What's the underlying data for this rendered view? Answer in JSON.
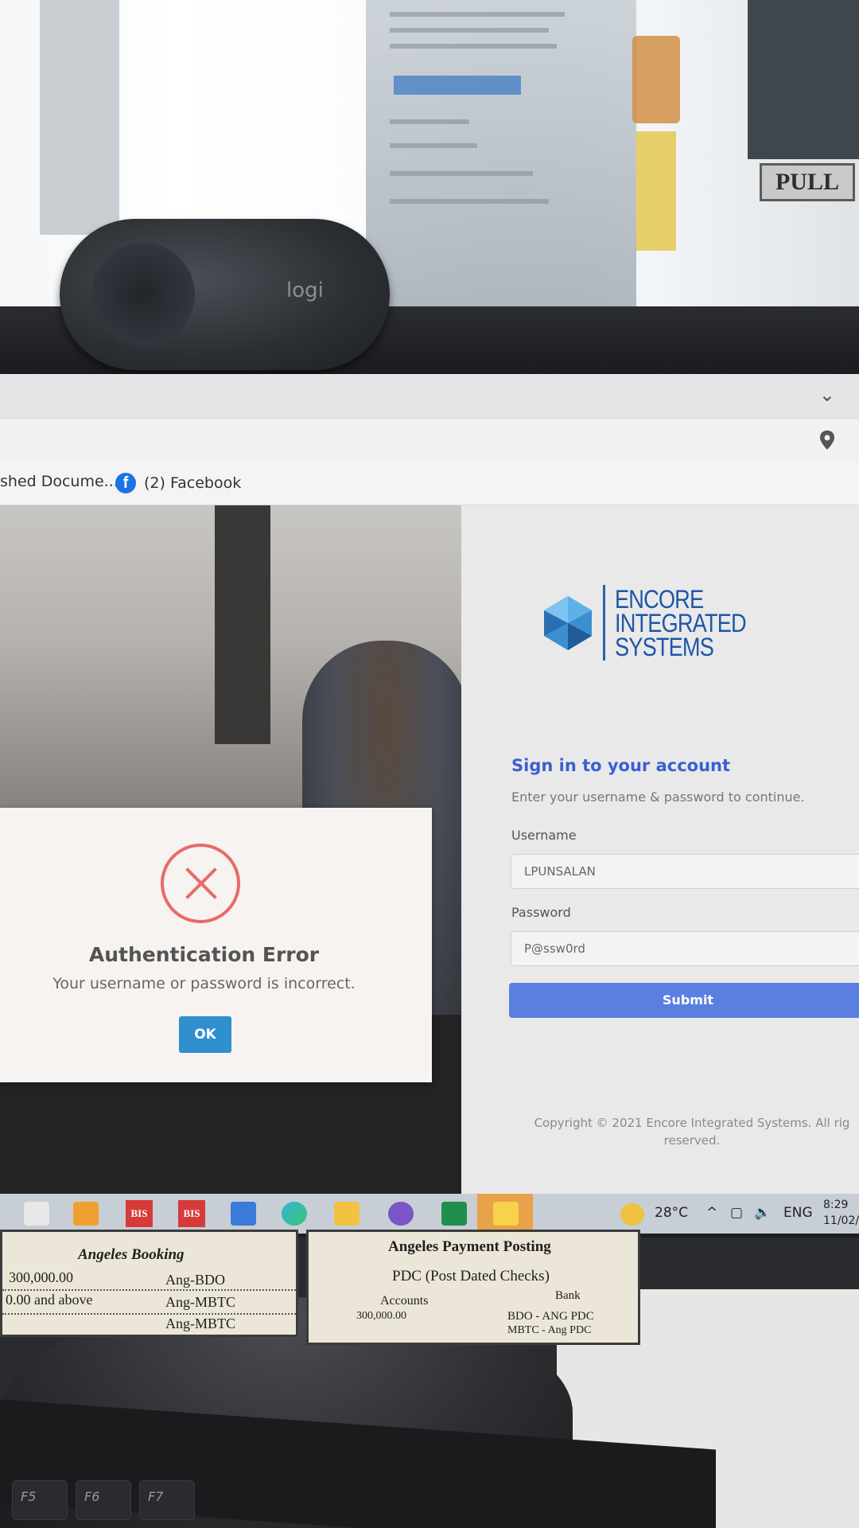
{
  "webcam": {
    "brand": "logi"
  },
  "background": {
    "sign_text": "PULL"
  },
  "browser": {
    "bookmarks": [
      {
        "label": "shed Docume..."
      },
      {
        "label": "(2) Facebook",
        "icon": "facebook-icon"
      }
    ]
  },
  "brand": {
    "logo_lines": [
      "ENCORE",
      "INTEGRATED",
      "SYSTEMS"
    ],
    "color": "#1f57a6"
  },
  "signin": {
    "title": "Sign in to your account",
    "subtitle": "Enter your username & password to continue.",
    "username_label": "Username",
    "username_value": "LPUNSALAN",
    "password_label": "Password",
    "password_value": "P@ssw0rd",
    "submit_label": "Submit",
    "copyright_line1": "Copyright © 2021 Encore Integrated Systems. All rig",
    "copyright_line2": "reserved."
  },
  "dialog": {
    "title": "Authentication Error",
    "message": "Your username or password is incorrect.",
    "ok_label": "OK",
    "accent": "#e86a6a"
  },
  "taskbar": {
    "bis_label": "BIS",
    "temperature": "28°C",
    "language": "ENG",
    "time": "8:29",
    "date": "11/02/"
  },
  "labels": {
    "left": {
      "title": "Angeles Booking",
      "rows": [
        {
          "amount": "300,000.00",
          "bank": "Ang-BDO"
        },
        {
          "amount": "0.00 and above",
          "bank": "Ang-MBTC"
        },
        {
          "amount": "",
          "bank": "Ang-MBTC"
        }
      ]
    },
    "right": {
      "title": "Angeles Payment Posting",
      "subtitle": "PDC (Post Dated Checks)",
      "col_accounts": "Accounts",
      "col_bank": "Bank",
      "row1_amount": "300,000.00",
      "row1_bank": "BDO - ANG PDC",
      "row2_bank": "MBTC - Ang PDC"
    }
  },
  "keyboard": {
    "keys": [
      "F5",
      "F6",
      "F7"
    ]
  }
}
